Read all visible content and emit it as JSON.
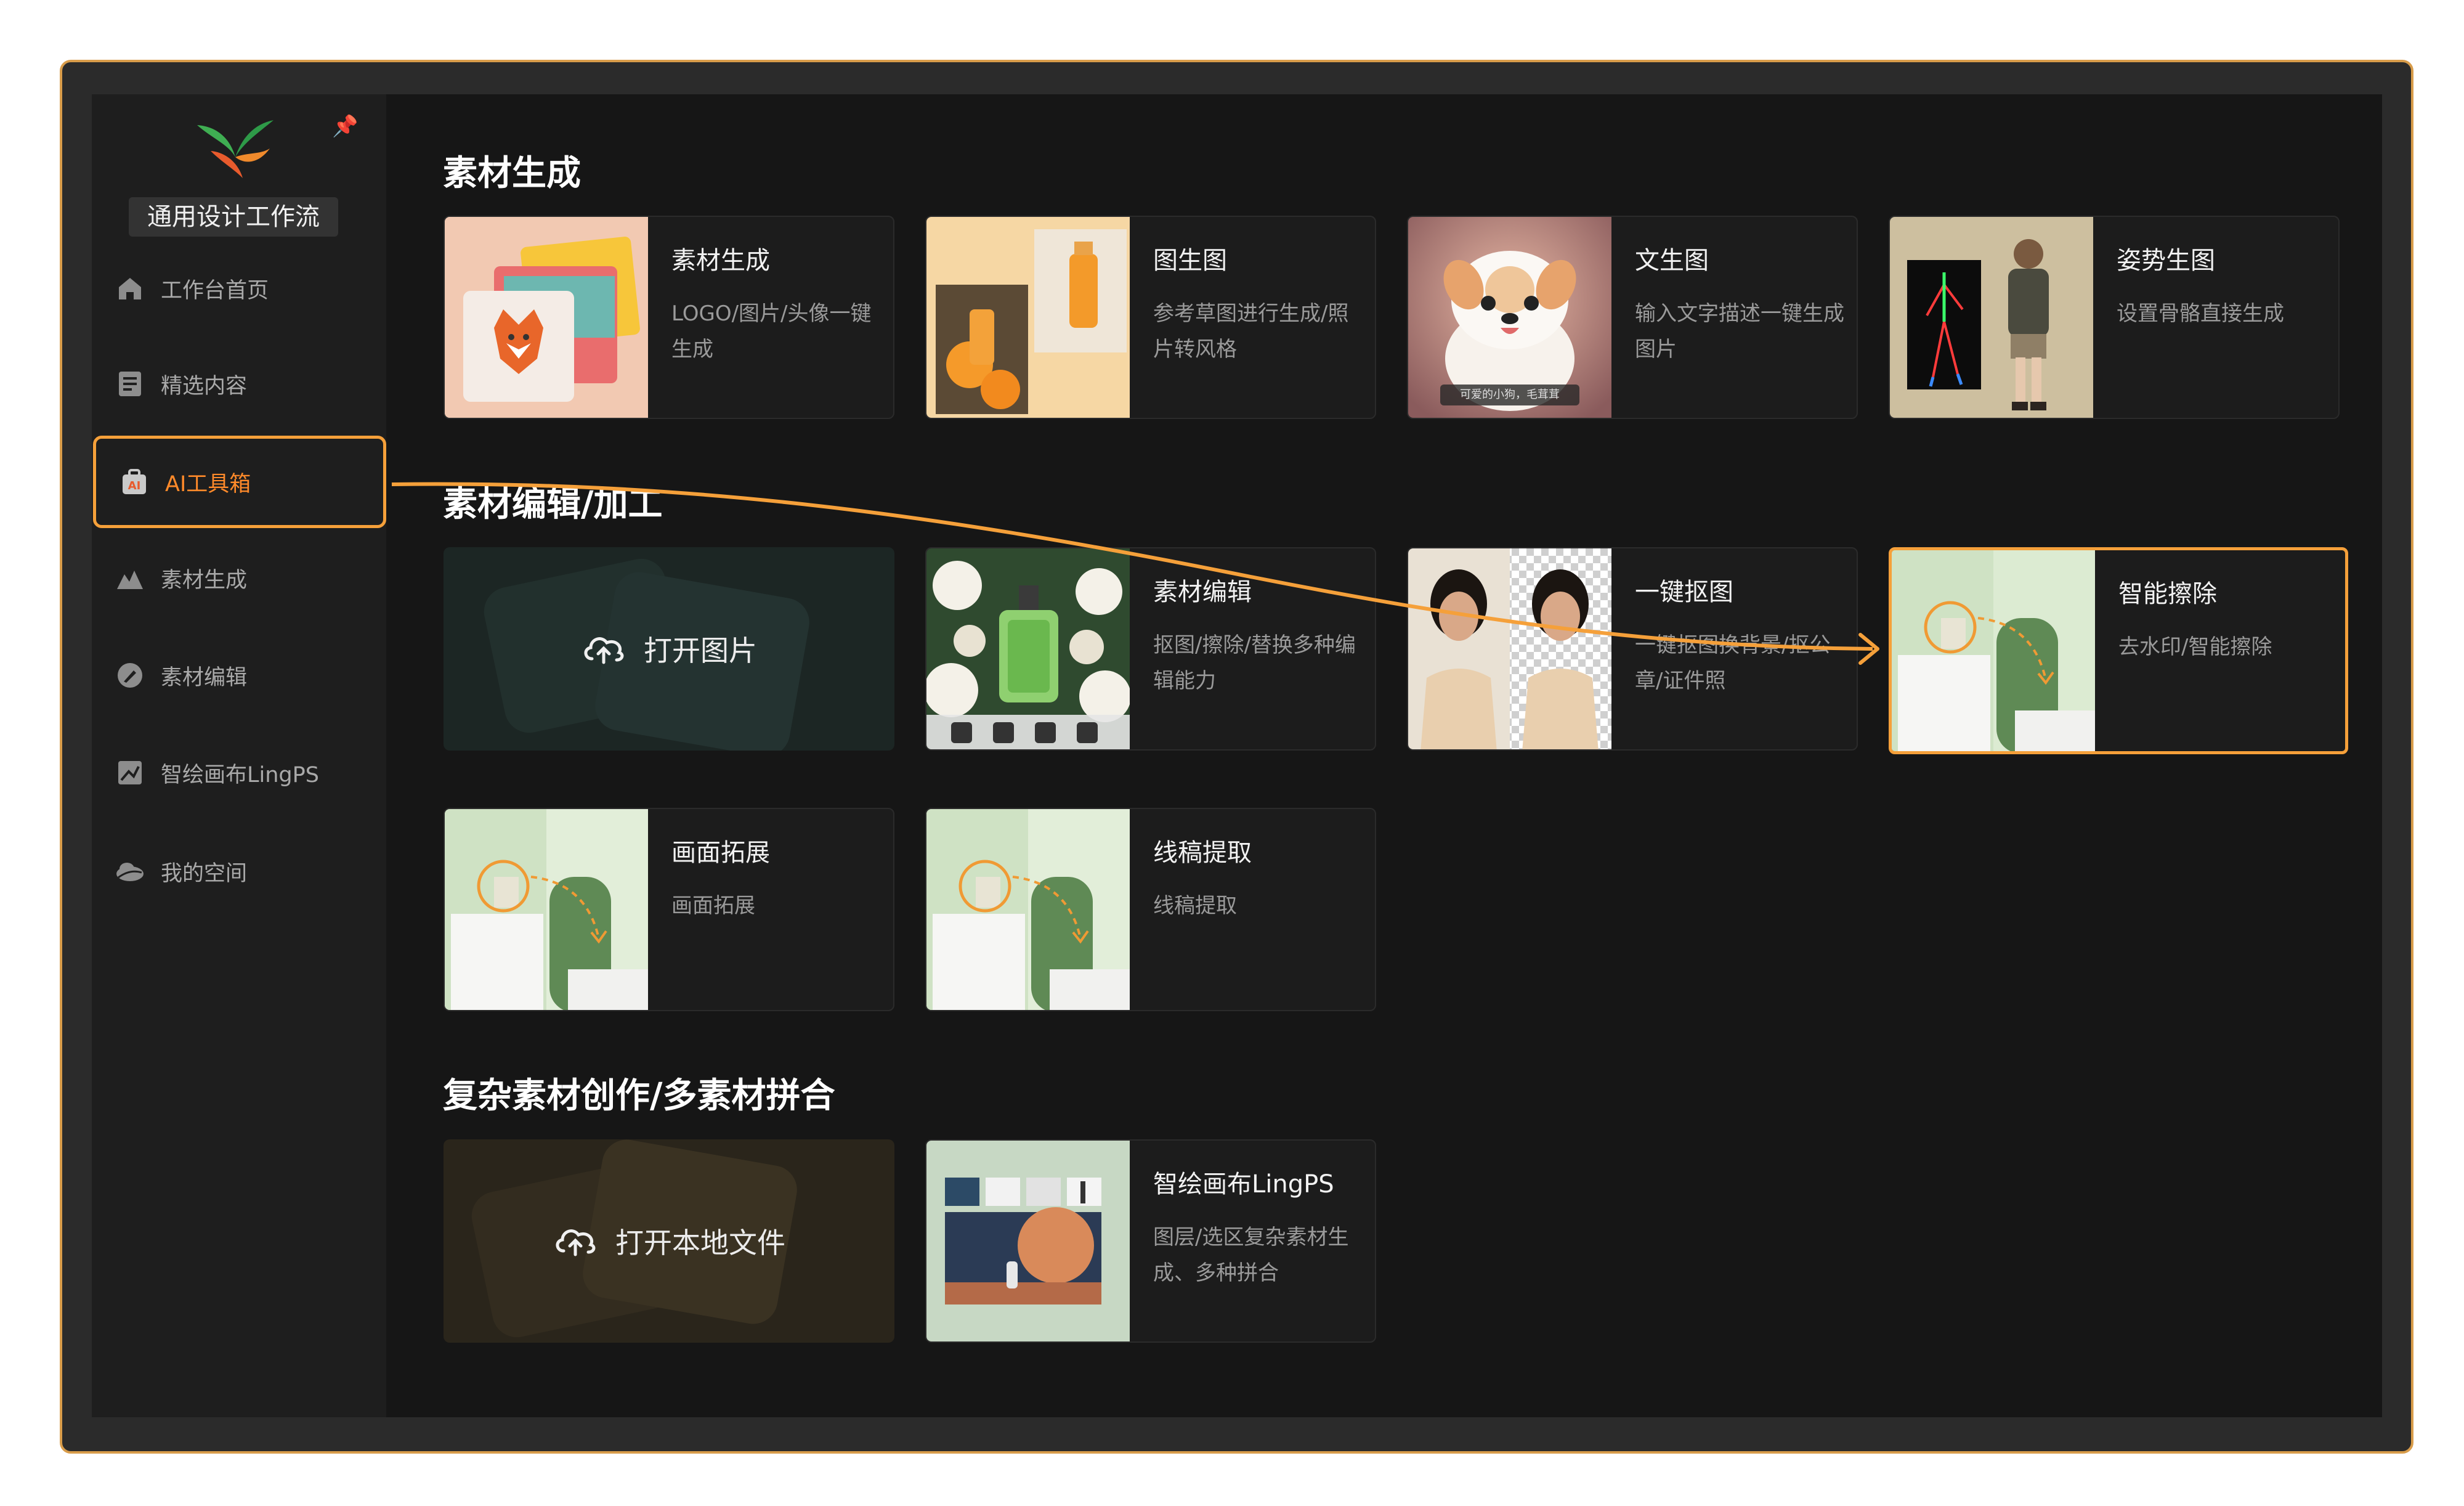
{
  "sidebar": {
    "workspace_label": "通用设计工作流",
    "items": [
      {
        "label": "工作台首页",
        "icon": "home-icon"
      },
      {
        "label": "精选内容",
        "icon": "document-icon"
      },
      {
        "label": "AI工具箱",
        "icon": "ai-toolbox-icon",
        "active": true
      },
      {
        "label": "素材生成",
        "icon": "material-generate-icon"
      },
      {
        "label": "素材编辑",
        "icon": "brush-icon"
      },
      {
        "label": "智绘画布LingPS",
        "icon": "canvas-icon"
      },
      {
        "label": "我的空间",
        "icon": "cloud-space-icon"
      }
    ]
  },
  "sections": {
    "generate": {
      "title": "素材生成",
      "cards": [
        {
          "title": "素材生成",
          "desc": "LOGO/图片/头像一键生成"
        },
        {
          "title": "图生图",
          "desc": "参考草图进行生成/照片转风格"
        },
        {
          "title": "文生图",
          "desc": "输入文字描述一键生成图片",
          "thumb_caption": "可爱的小狗，毛茸茸"
        },
        {
          "title": "姿势生图",
          "desc": "设置骨骼直接生成"
        }
      ]
    },
    "edit": {
      "title": "素材编辑/加工",
      "upload_label": "打开图片",
      "cards": [
        {
          "title": "素材编辑",
          "desc": "抠图/擦除/替换多种编辑能力"
        },
        {
          "title": "一键抠图",
          "desc": "一键抠图换背景/抠公章/证件照"
        },
        {
          "title": "智能擦除",
          "desc": "去水印/智能擦除"
        },
        {
          "title": "画面拓展",
          "desc": "画面拓展"
        },
        {
          "title": "线稿提取",
          "desc": "线稿提取"
        }
      ]
    },
    "compose": {
      "title": "复杂素材创作/多素材拼合",
      "upload_label": "打开本地文件",
      "cards": [
        {
          "title": "智绘画布LingPS",
          "desc": "图层/选区复杂素材生成、多种拼合"
        }
      ]
    }
  },
  "colors": {
    "accent": "#f5a03a",
    "active_text": "#ff8a2a",
    "background": "#161616",
    "sidebar": "#1e1e1e",
    "card": "#1c1c1c"
  }
}
